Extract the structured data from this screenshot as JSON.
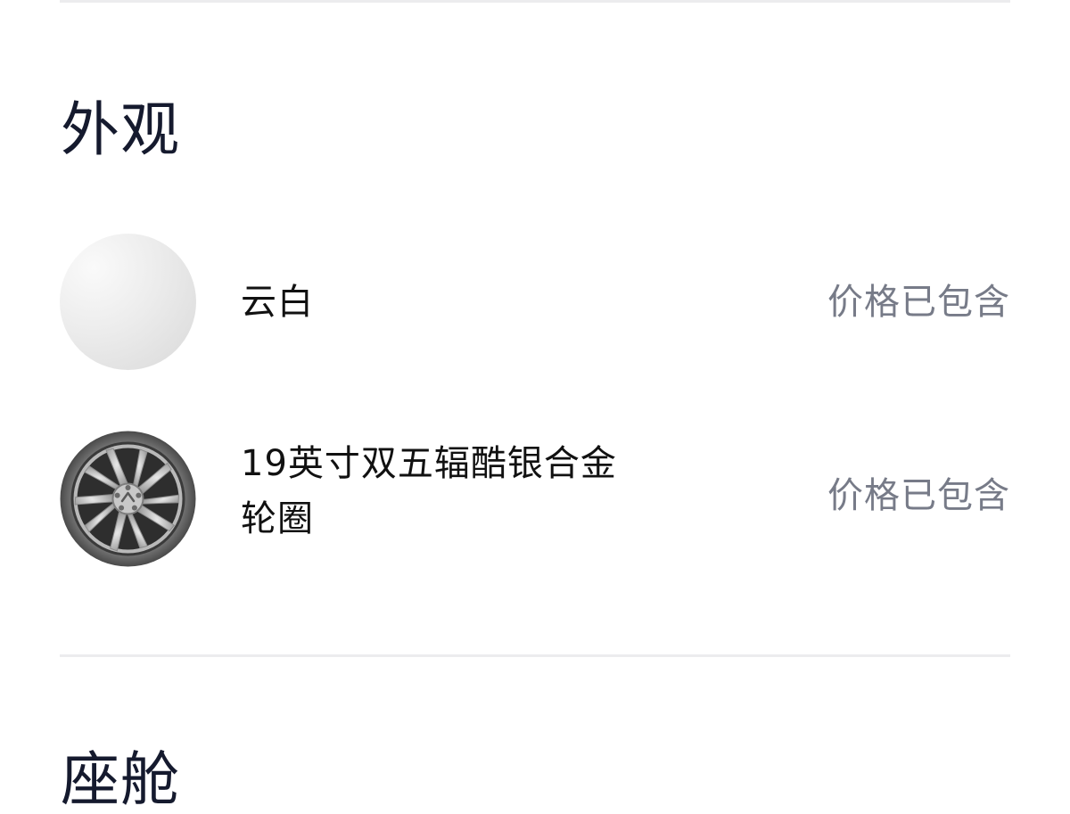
{
  "sections": {
    "exterior": {
      "title": "外观",
      "options": [
        {
          "name": "云白",
          "price_text": "价格已包含",
          "thumbnail": "white-color-swatch"
        },
        {
          "name_line1": "19英寸双五辐酷银合金",
          "name_line2": "轮圈",
          "price_text": "价格已包含",
          "thumbnail": "alloy-wheel-image"
        }
      ]
    },
    "cabin": {
      "title": "座舱"
    }
  },
  "colors": {
    "title_text": "#151a2e",
    "price_text": "#777b88",
    "divider": "#ececee"
  }
}
